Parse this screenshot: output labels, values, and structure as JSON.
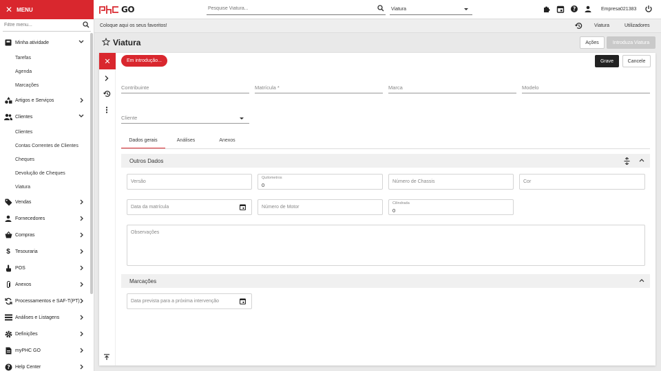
{
  "topbar": {
    "menu_label": "MENU",
    "logo_text": "GO",
    "search_placeholder": "Pesquise Viatura...",
    "entity_select": "Viatura",
    "company": "Empresa021383"
  },
  "sidebar": {
    "filter_placeholder": "Filtre menu...",
    "items": [
      {
        "label": "Minha atividade",
        "icon": "briefcase-icon",
        "expanded": true
      },
      {
        "label": "Tarefas"
      },
      {
        "label": "Agenda"
      },
      {
        "label": "Marcações"
      },
      {
        "label": "Artigos e Serviços",
        "icon": "shapes-icon"
      },
      {
        "label": "Clientes",
        "icon": "people-icon",
        "expanded": true
      },
      {
        "label": "Clientes"
      },
      {
        "label": "Contas Correntes de Clientes"
      },
      {
        "label": "Cheques"
      },
      {
        "label": "Devolução de Cheques"
      },
      {
        "label": "Viatura"
      },
      {
        "label": "Vendas",
        "icon": "tag-icon"
      },
      {
        "label": "Fornecedores",
        "icon": "person-icon"
      },
      {
        "label": "Compras",
        "icon": "basket-icon"
      },
      {
        "label": "Tesouraria",
        "icon": "dollar-icon"
      },
      {
        "label": "POS",
        "icon": "touch-icon"
      },
      {
        "label": "Anexos",
        "icon": "paperclip-icon"
      },
      {
        "label": "Processamentos e SAF-T(PT)",
        "icon": "sync-icon"
      },
      {
        "label": "Análises e Listagens",
        "icon": "list-icon"
      },
      {
        "label": "Definições",
        "icon": "gear-icon"
      },
      {
        "label": "myPHC GO",
        "icon": "document-icon"
      },
      {
        "label": "Help Center",
        "icon": "help-icon"
      }
    ]
  },
  "favbar": {
    "text": "Coloque aqui os seus favoritos!",
    "viatura": "Viatura",
    "users": "Utilizadores"
  },
  "page": {
    "title": "Viatura",
    "acoes": "Ações",
    "introduza": "Introduza Viatura"
  },
  "form": {
    "status": "Em introdução...",
    "save": "Grave",
    "cancel": "Cancele",
    "fields": {
      "contribuinte": "Contribuinte",
      "matricula": "Matrícula *",
      "marca": "Marca",
      "modelo": "Modelo",
      "cliente": "Cliente"
    },
    "tabs": [
      "Dados gerais",
      "Análises",
      "Anexos"
    ],
    "outros_dados": {
      "title": "Outros Dados",
      "versao": "Versão",
      "quilometros_label": "Quilometros",
      "quilometros_value": "0",
      "chassis": "Número de Chassis",
      "cor": "Cor",
      "data_matricula": "Data da matrícula",
      "motor": "Número de Motor",
      "cilindrada_label": "Cilindrada",
      "cilindrada_value": "0",
      "observacoes": "Observações"
    },
    "marcacoes": {
      "title": "Marcações",
      "proxima": "Data prevista para a próxima intervenção"
    }
  },
  "colors": {
    "brand_red": "#d9272e",
    "dark_button": "#222222"
  }
}
